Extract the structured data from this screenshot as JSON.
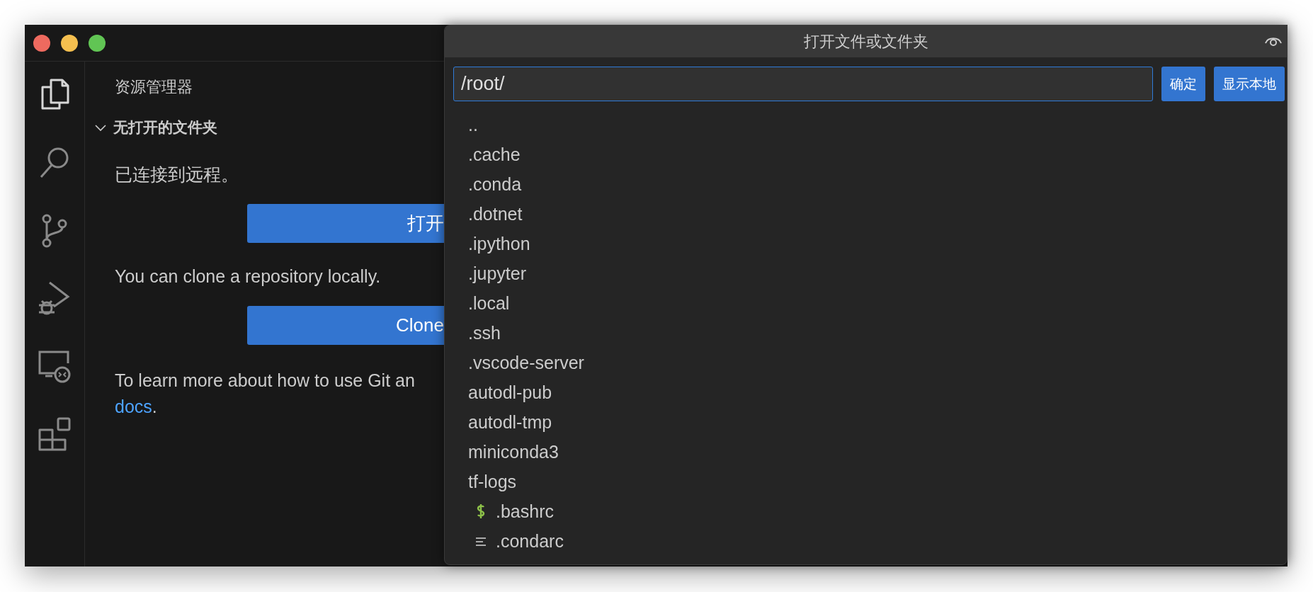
{
  "window": {
    "controls": [
      {
        "color": "#ee6a5f"
      },
      {
        "color": "#f5bf4f"
      },
      {
        "color": "#61c554"
      }
    ]
  },
  "activity_bar": {
    "items": [
      {
        "kind": "files",
        "selected": true
      },
      {
        "kind": "search",
        "selected": false
      },
      {
        "kind": "branch",
        "selected": false
      },
      {
        "kind": "debug",
        "selected": false
      },
      {
        "kind": "remote",
        "selected": false
      },
      {
        "kind": "blocks",
        "selected": false
      }
    ]
  },
  "sidebar": {
    "title": "资源管理器",
    "section": {
      "label": "无打开的文件夹",
      "expanded": true
    },
    "content": [
      {
        "kind": "text",
        "text": "已连接到远程。"
      },
      {
        "kind": "button",
        "label": "打开"
      },
      {
        "kind": "text",
        "text": "You can clone a repository locally."
      },
      {
        "kind": "button",
        "label": "Clone"
      },
      {
        "kind": "text",
        "text": "To learn more about how to use Git an",
        "link": "docs",
        "after": "."
      }
    ]
  },
  "dialog": {
    "title": "打开文件或文件夹",
    "path_value": "/root/",
    "buttons": [
      "确定",
      "显示本地"
    ],
    "entries": [
      {
        "name": "..",
        "kind": "folder"
      },
      {
        "name": ".cache",
        "kind": "folder"
      },
      {
        "name": ".conda",
        "kind": "folder"
      },
      {
        "name": ".dotnet",
        "kind": "folder"
      },
      {
        "name": ".ipython",
        "kind": "folder"
      },
      {
        "name": ".jupyter",
        "kind": "folder"
      },
      {
        "name": ".local",
        "kind": "folder"
      },
      {
        "name": ".ssh",
        "kind": "folder"
      },
      {
        "name": ".vscode-server",
        "kind": "folder"
      },
      {
        "name": "autodl-pub",
        "kind": "folder"
      },
      {
        "name": "autodl-tmp",
        "kind": "folder"
      },
      {
        "name": "miniconda3",
        "kind": "folder"
      },
      {
        "name": "tf-logs",
        "kind": "folder"
      },
      {
        "name": ".bashrc",
        "kind": "shell"
      },
      {
        "name": ".condarc",
        "kind": "config"
      }
    ]
  }
}
